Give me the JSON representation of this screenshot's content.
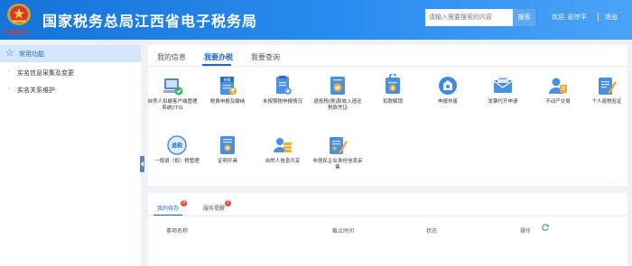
{
  "header": {
    "emblem_caption": "中国税务",
    "title": "国家税务总局江西省电子税务局",
    "search_placeholder": "请输入需要搜索的内容",
    "search_button": "搜索",
    "welcome": "欢迎, 彭宗平",
    "logout": "退出"
  },
  "sidebar": {
    "heading": "常用功能",
    "items": [
      {
        "label": "实名信息采集及变更"
      },
      {
        "label": "实名关系维护"
      }
    ]
  },
  "main": {
    "tabs": [
      {
        "label": "我的信息",
        "active": false
      },
      {
        "label": "我要办税",
        "active": true
      },
      {
        "label": "我要查询",
        "active": false
      }
    ],
    "services": [
      {
        "label": "自然人扣缴客户端管理系统(ITS)",
        "icon": "computer-check-icon"
      },
      {
        "label": "税费申报及缴纳",
        "icon": "tax-declaration-icon"
      },
      {
        "label": "未按期税申报情况",
        "icon": "unfiled-report-icon"
      },
      {
        "label": "退抵税(费)款收入退还税款凭证",
        "icon": "refund-voucher-icon"
      },
      {
        "label": "扣款解锁",
        "icon": "unlock-payment-icon"
      },
      {
        "label": "申报作废",
        "icon": "void-declaration-icon"
      },
      {
        "label": "发票代开申请",
        "icon": "invoice-mail-icon"
      },
      {
        "label": "不动产交易",
        "icon": "real-estate-person-icon"
      },
      {
        "label": "个人退税验证",
        "icon": "refund-verify-icon"
      },
      {
        "label": "一般退（抵）税管理",
        "icon": "refund-circle-icon"
      },
      {
        "label": "证明开具",
        "icon": "certificate-icon"
      },
      {
        "label": "自然人信息共享",
        "icon": "info-share-icon"
      },
      {
        "label": "非居民企业身份信息采集",
        "icon": "nonresident-info-icon"
      }
    ]
  },
  "todo": {
    "tabs": [
      {
        "label": "我的待办",
        "badge": "0",
        "active": true
      },
      {
        "label": "服务提醒",
        "badge": "0",
        "active": false
      }
    ],
    "columns": [
      "事项名称",
      "截止时间",
      "状态",
      "操作"
    ]
  },
  "colors": {
    "header_blue": "#1a73d8",
    "accent": "#1a67c8",
    "badge_red": "#e8483b"
  }
}
